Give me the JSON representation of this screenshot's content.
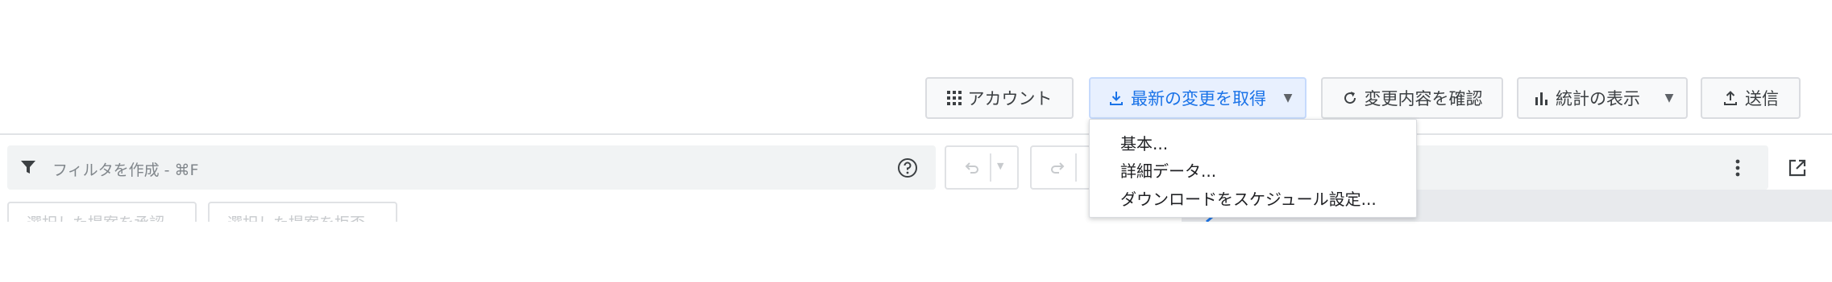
{
  "toolbar": {
    "account_label": "アカウント",
    "download_label": "最新の変更を取得",
    "review_changes_label": "変更内容を確認",
    "stats_label": "統計の表示",
    "post_label": "送信"
  },
  "download_menu": {
    "items": [
      {
        "label": "基本..."
      },
      {
        "label": "詳細データ..."
      },
      {
        "label": "ダウンロードをスケジュール設定..."
      }
    ]
  },
  "filter": {
    "placeholder": "フィルタを作成 - ⌘F"
  },
  "proposals": {
    "accept_label": "選択した提案を承認",
    "reject_label": "選択した提案を拒否"
  },
  "colors": {
    "accent": "#1a73e8",
    "accent_bg": "#e8f0fe",
    "text": "#3c4043",
    "muted": "#80868b",
    "border": "#dadce0"
  },
  "icons": [
    "apps-icon",
    "download-icon",
    "chevron-down-icon",
    "refresh-icon",
    "bar-chart-icon",
    "upload-icon",
    "filter-icon",
    "help-icon",
    "undo-icon",
    "redo-icon",
    "more-vert-icon",
    "open-in-new-icon"
  ]
}
